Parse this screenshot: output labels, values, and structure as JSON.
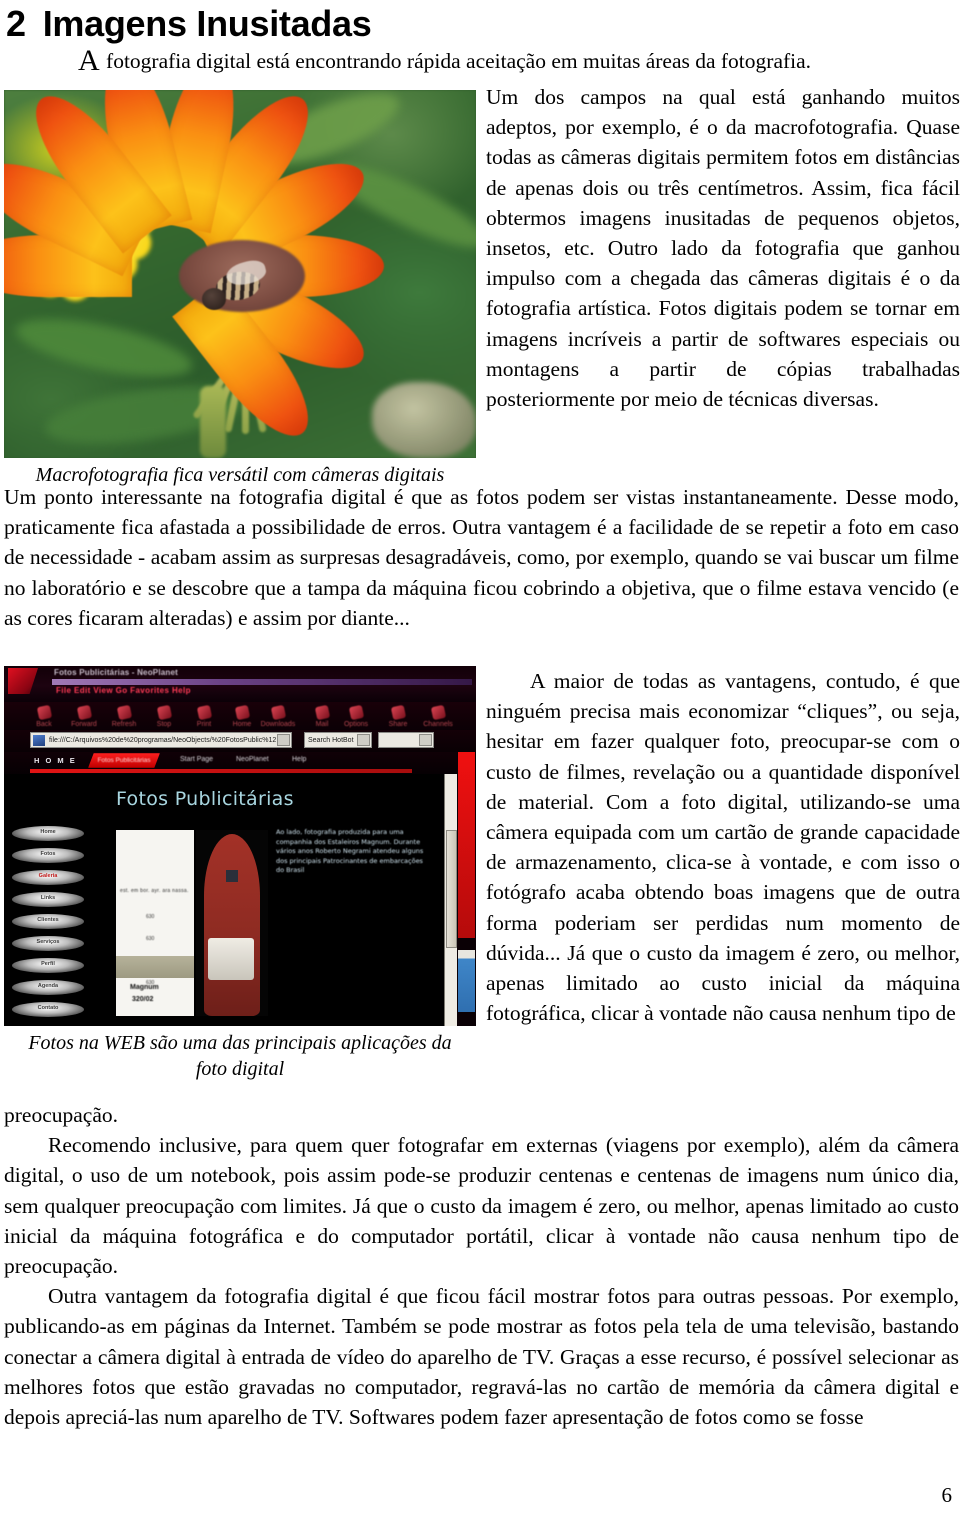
{
  "heading": {
    "number": "2",
    "title": "Imagens Inusitadas"
  },
  "intro": {
    "dropcap": "A",
    "rest": " fotografia digital está encontrando rápida aceitação em muitas áreas da fotografia."
  },
  "flower_figure": {
    "caption": "Macrofotografia fica versátil com câmeras digitais",
    "alt": "Macro photograph of a bee resting on an orange and yellow gazania flower with blurred green foliage"
  },
  "web_figure": {
    "caption_line1": "Fotos na WEB são uma das principais aplicações da",
    "caption_line2": "foto digital",
    "browser": {
      "window_title": "Fotos Publicitárias - NeoPlanet",
      "menu": "File  Edit  View  Go  Favorites  Help",
      "toolbar_items": [
        "Back",
        "Forward",
        "Refresh",
        "Stop",
        "Print",
        "Home",
        "Downloads",
        "Mail",
        "Options",
        "Share",
        "Channels"
      ],
      "address_value": "file:///C:/Arquivos%20de%20programas/NeoObjects/%20FotosPublic%12",
      "search_value": "Search HotBot",
      "home_label": "H O M E",
      "active_tab": "Fotos Publicitárias",
      "tabs": [
        "Start Page",
        "NeoPlanet",
        "Help"
      ]
    },
    "page": {
      "title": "Fotos Publicitárias",
      "side_text": "Ao lado, fotografia produzida para uma companhia dos Estaleiros Magnum. Durante vários anos Roberto Negrami atendeu alguns dos principais Patrocinantes de embarcações do Brasil",
      "nav_pills": [
        "Home",
        "Fotos",
        "Galeria",
        "Links",
        "Clientes",
        "Serviços",
        "Perfil",
        "Agenda",
        "Contato"
      ],
      "selected_pill_index": 2,
      "photo_caption_brand": "Magnum",
      "photo_caption_model": "320/02"
    }
  },
  "columns": {
    "right_top": "Um dos campos na qual está ganhando muitos adeptos, por exemplo, é o da macrofotografia. Quase todas as câmeras digitais permitem fotos em distâncias de apenas dois ou três centímetros. Assim, fica fácil obtermos imagens inusitadas de pequenos objetos, insetos, etc. Outro lado da fotografia que ganhou impulso com a chegada das câmeras digitais é o da fotografia artística. Fotos digitais podem se tornar em imagens incríveis a partir de softwares especiais ou montagens a partir de cópias trabalhadas posteriormente por meio de técnicas diversas.",
    "mid_block": "Um ponto interessante na fotografia digital é que as fotos podem ser vistas instantaneamente. Desse modo, praticamente fica afastada a possibilidade de erros. Outra vantagem é a facilidade de se repetir a foto em caso de necessidade - acabam assim as surpresas desagradáveis, como, por exemplo, quando se vai buscar um filme no laboratório e se descobre que a tampa da máquina ficou cobrindo a objetiva, que o filme estava vencido (e as cores ficaram alteradas) e assim por diante...",
    "right_mid": "A maior de todas as vantagens, contudo, é que ninguém precisa mais economizar “cliques”, ou seja, hesitar em fazer qualquer foto, preocupar-se com o custo de filmes, revelação ou a quantidade disponível de material. Com a foto digital, utilizando-se uma câmera equipada com um cartão de grande capacidade de armazenamento, clica-se à vontade, e com isso o fotógrafo acaba obtendo boas imagens que de outra forma poderiam ser perdidas num momento de dúvida... Já que o custo da imagem é zero, ou melhor, apenas limitado ao custo inicial da máquina fotográfica, clicar à vontade não causa nenhum tipo de",
    "bottom_tail": "preocupação.",
    "bottom_p1": "Recomendo inclusive, para quem quer fotografar em externas (viagens por exemplo), além da câmera digital, o uso de um notebook, pois assim pode-se produzir centenas e centenas de imagens num único dia, sem qualquer preocupação com limites. Já que o custo da imagem é zero, ou melhor, apenas limitado ao custo inicial da máquina fotográfica e do computador portátil, clicar à vontade não causa nenhum tipo de preocupação.",
    "bottom_p2": "Outra vantagem da fotografia digital é que ficou fácil mostrar fotos para outras pessoas. Por exemplo, publicando-as em páginas da Internet. Também se pode mostrar as fotos pela tela de uma televisão, bastando conectar a câmera digital à entrada de vídeo do aparelho de TV. Graças a esse recurso, é possível selecionar as melhores fotos que estão gravadas no computador, regravá-las no cartão de memória da câmera digital e depois apreciá-las num aparelho de TV. Softwares podem fazer apresentação de fotos como se fosse"
  },
  "footer": {
    "page_number": "6"
  }
}
